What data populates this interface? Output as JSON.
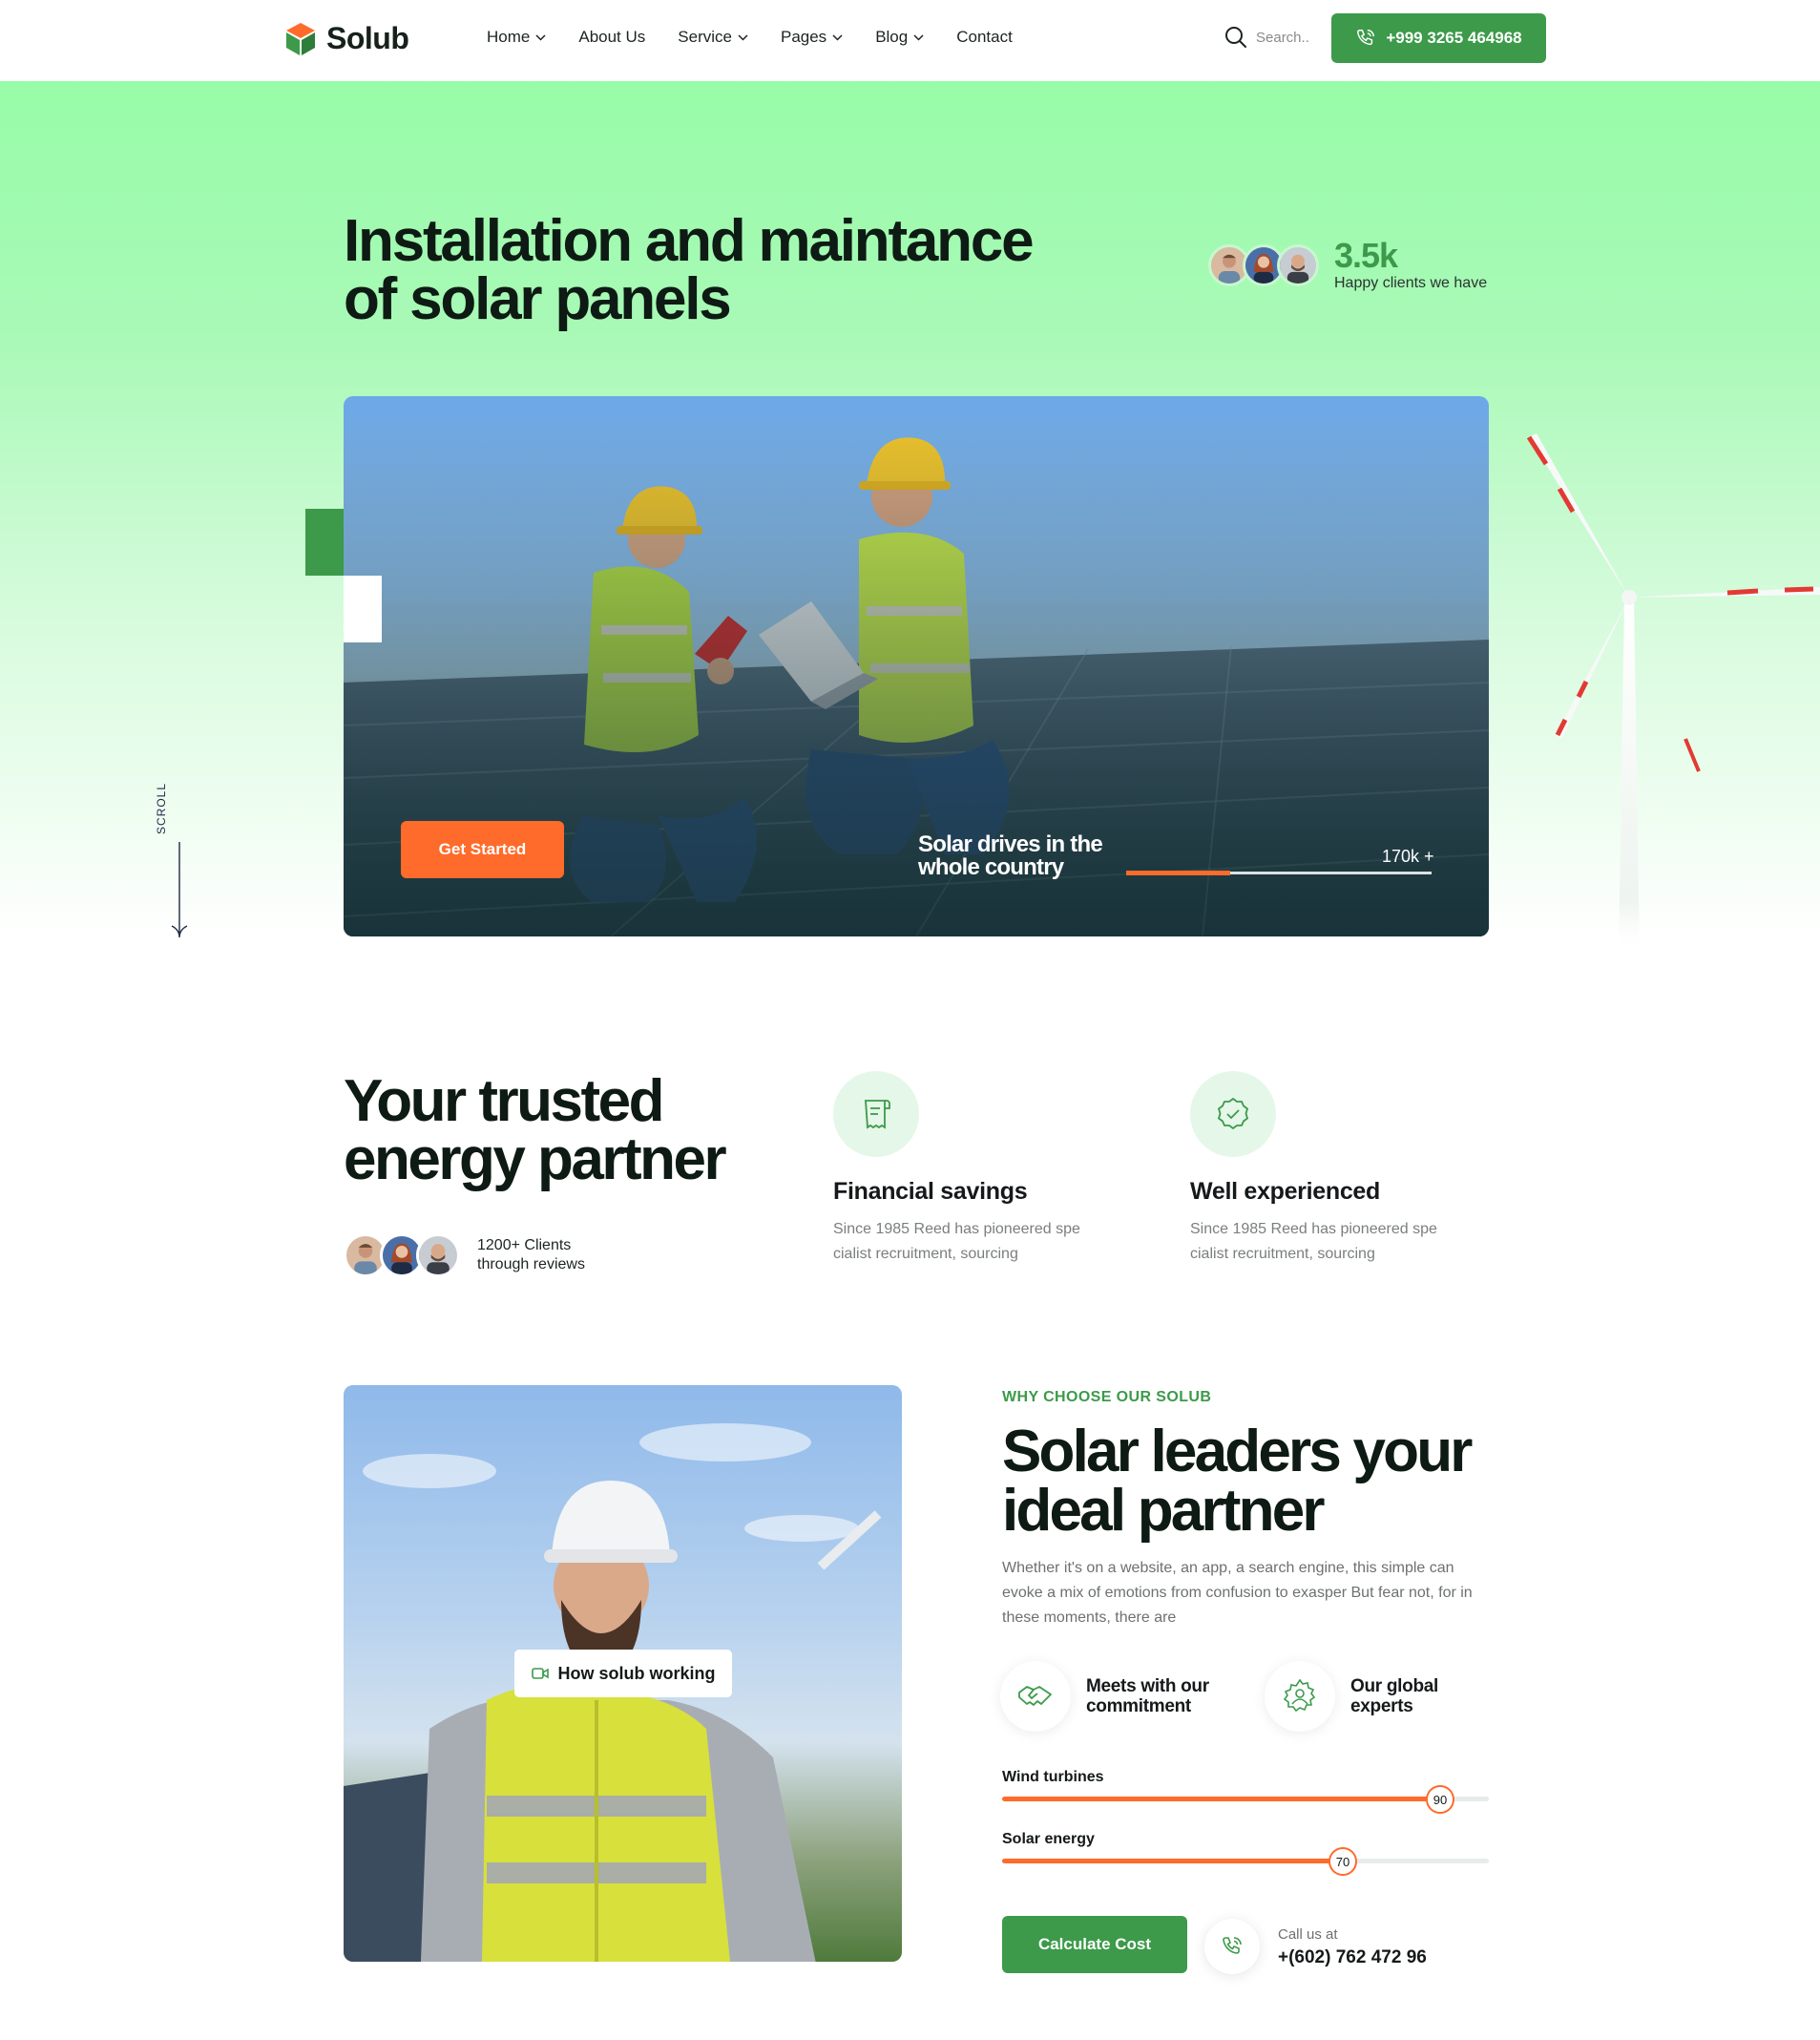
{
  "brand": {
    "name": "Solub",
    "accent": "#3c9a4a",
    "orange": "#ff6b2a"
  },
  "nav": [
    {
      "label": "Home",
      "dropdown": true
    },
    {
      "label": "About Us",
      "dropdown": false
    },
    {
      "label": "Service",
      "dropdown": true
    },
    {
      "label": "Pages",
      "dropdown": true
    },
    {
      "label": "Blog",
      "dropdown": true
    },
    {
      "label": "Contact",
      "dropdown": false
    }
  ],
  "search": {
    "placeholder": "Search.."
  },
  "header_phone": "+999 3265 464968",
  "hero": {
    "title": "Installation and maintance of solar panels",
    "happy_count": "3.5k",
    "happy_label": "Happy clients we have",
    "cta": "Get Started",
    "caption": "Solar drives in the whole country",
    "stat": "170k +",
    "stat_progress": 0.34,
    "scroll_label": "SCROLL"
  },
  "trusted": {
    "title": "Your trusted energy partner",
    "clients_text": "1200+ Clients through reviews",
    "features": [
      {
        "icon": "receipt-icon",
        "title": "Financial savings",
        "desc": "Since 1985 Reed has pioneered spe cialist recruitment, sourcing"
      },
      {
        "icon": "badge-check-icon",
        "title": "Well experienced",
        "desc": "Since 1985 Reed has pioneered spe cialist recruitment, sourcing"
      }
    ]
  },
  "why": {
    "eyebrow": "WHY CHOOSE OUR SOLUB",
    "title": "Solar leaders your ideal partner",
    "desc": "Whether it's on a website, an app, a search engine, this simple can evoke a mix of emotions from confusion to exasper But fear not, for in these moments, there are",
    "video_label": "How solub working",
    "mini": [
      {
        "icon": "handshake-icon",
        "label": "Meets with our commitment"
      },
      {
        "icon": "gear-team-icon",
        "label": "Our global experts"
      }
    ],
    "bars": [
      {
        "label": "Wind turbines",
        "value": 90,
        "display": "90"
      },
      {
        "label": "Solar energy",
        "value": 70,
        "display": "70"
      }
    ],
    "cta": "Calculate Cost",
    "call_label": "Call us at",
    "call_number": "+(602) 762 472 96"
  }
}
